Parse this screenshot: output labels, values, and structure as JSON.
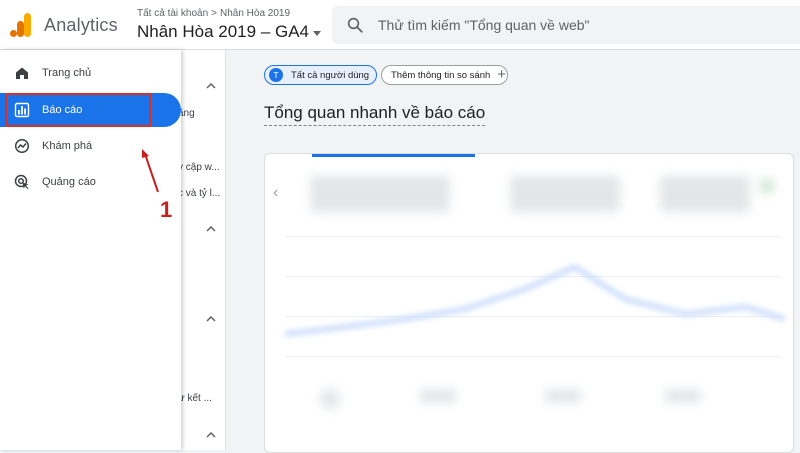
{
  "header": {
    "app_name": "Analytics",
    "breadcrumb": [
      "Tất cả tài khoản",
      "Nhân Hòa 2019"
    ],
    "property_name": "Nhân Hòa 2019 – GA4",
    "search_placeholder": "Thử tìm kiếm \"Tổng quan về web\""
  },
  "sidebar": {
    "items": [
      {
        "label": "Trang chủ",
        "icon": "home-icon"
      },
      {
        "label": "Báo cáo",
        "icon": "bar-chart-icon",
        "active": true
      },
      {
        "label": "Khám phá",
        "icon": "explore-icon"
      },
      {
        "label": "Quảng cáo",
        "icon": "ads-icon"
      }
    ]
  },
  "subnav": {
    "fragments": [
      "ăng",
      "y cập w...",
      "c và tỷ l...",
      "ừ kết ..."
    ]
  },
  "main": {
    "chip_all_avatar": "T",
    "chip_all_label": "Tất cả người dùng",
    "chip_compare_label": "Thêm thông tin so sánh",
    "page_title": "Tổng quan nhanh về báo cáo"
  },
  "annotation": {
    "number": "1"
  },
  "colors": {
    "accent": "#1a73e8",
    "annotation_red": "#d93025",
    "logo_orange": "#f9ab00",
    "logo_dark_orange": "#e37400"
  }
}
